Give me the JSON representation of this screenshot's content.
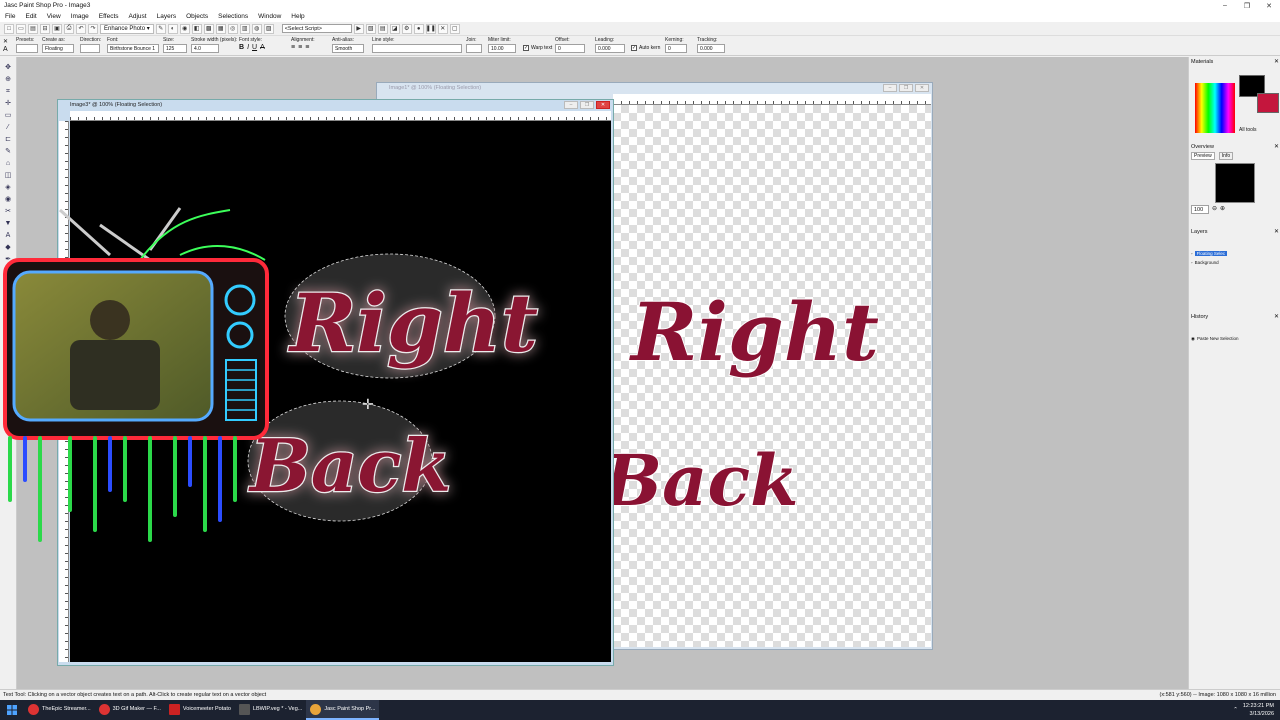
{
  "window": {
    "title": "Jasc Paint Shop Pro - Image3",
    "controls": [
      "–",
      "❐",
      "✕"
    ]
  },
  "menu": [
    "File",
    "Edit",
    "View",
    "Image",
    "Effects",
    "Adjust",
    "Layers",
    "Objects",
    "Selections",
    "Window",
    "Help"
  ],
  "toolbar": {
    "enhance_photo": "Enhance Photo ▾",
    "select_script": "<Select Script>"
  },
  "tool_options": {
    "presets_label": "Presets:",
    "create_as_label": "Create as:",
    "create_as_value": "Floating",
    "direction_label": "Direction:",
    "font_label": "Font:",
    "font_value": "Birthstone Bounce 1",
    "size_label": "Size:",
    "size_value": "125",
    "stroke_label": "Stroke width (pixels):",
    "stroke_value": "4.0",
    "font_style_label": "Font style:",
    "alignment_label": "Alignment:",
    "antialias_label": "Anti-alias:",
    "antialias_value": "Smooth",
    "line_style_label": "Line style:",
    "join_label": "Join:",
    "miter_label": "Miter limit:",
    "miter_value": "10.00",
    "warp_text": "Warp text",
    "offset_label": "Offset:",
    "offset_value": "0",
    "leading_label": "Leading:",
    "leading_value": "0.000",
    "auto_kern": "Auto kern",
    "kerning_label": "Kerning:",
    "kerning_value": "0",
    "tracking_label": "Tracking:",
    "tracking_value": "0.000"
  },
  "documents": {
    "front_title": "Image3* @ 100% (Floating Selection)",
    "back_title": "Image1* @ 100% (Floating Selection)"
  },
  "canvas_text": {
    "line1": "Right",
    "line2": "Back"
  },
  "panels": {
    "materials": "Materials",
    "all_tools": "All tools",
    "overview": "Overview",
    "preview_tab": "Preview",
    "info_tab": "Info",
    "zoom_value": "100",
    "layers": "Layers",
    "layer_items": [
      "Floating Selec",
      "Background"
    ],
    "history": "History",
    "history_items": [
      "Paste New Selection"
    ]
  },
  "status": {
    "left": "Text Tool: Clicking on a vector object creates text on a path. Alt-Click to create regular text on a vector object",
    "right": "(x:581 y:560) -- Image: 1080 x 1080 x 16 million"
  },
  "taskbar": {
    "apps": [
      "TheEpic Streamer...",
      "3D Gif Maker — F...",
      "Voicemeeter Potato",
      "LBWIP.veg * - Veg...",
      "Jasc Paint Shop Pr..."
    ],
    "time": "12:23:21 PM",
    "date": "3/13/2026"
  },
  "colors": {
    "text_fill": "#8a1233",
    "text_stroke": "#e8e8e8",
    "canvas_bg": "#000000"
  }
}
